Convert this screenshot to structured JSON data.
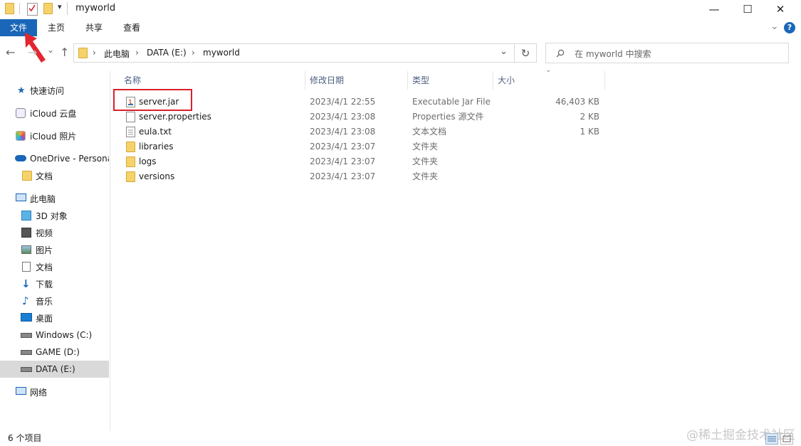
{
  "window": {
    "title": "myworld"
  },
  "title_controls": {
    "minimize": "—",
    "maximize": "☐",
    "close": "✕"
  },
  "ribbon": {
    "tabs": [
      "文件",
      "主页",
      "共享",
      "查看"
    ],
    "expand_glyph": "⌄",
    "help": "?"
  },
  "nav": {
    "back": "←",
    "forward": "→",
    "recent": "⌄",
    "up": "↑"
  },
  "address": {
    "segments": [
      "此电脑",
      "DATA (E:)",
      "myworld"
    ],
    "separator": "›",
    "dropdown": "⌄",
    "refresh": "↻"
  },
  "search": {
    "placeholder": "在 myworld 中搜索"
  },
  "sidebar": {
    "items": [
      {
        "label": "快速访问",
        "icon": "star-icon"
      },
      {
        "label": "iCloud 云盘",
        "icon": "icloud-icon"
      },
      {
        "label": "iCloud 照片",
        "icon": "icloud-photos-icon"
      },
      {
        "label": "OneDrive - Persona",
        "icon": "onedrive-icon"
      },
      {
        "label": "文档",
        "icon": "folder-icon"
      },
      {
        "label": "此电脑",
        "icon": "computer-icon"
      },
      {
        "label": "3D 对象",
        "icon": "cube-icon"
      },
      {
        "label": "视频",
        "icon": "video-icon"
      },
      {
        "label": "图片",
        "icon": "pictures-icon"
      },
      {
        "label": "文档",
        "icon": "documents-icon"
      },
      {
        "label": "下载",
        "icon": "download-icon"
      },
      {
        "label": "音乐",
        "icon": "music-icon"
      },
      {
        "label": "桌面",
        "icon": "desktop-icon"
      },
      {
        "label": "Windows (C:)",
        "icon": "drive-icon"
      },
      {
        "label": "GAME (D:)",
        "icon": "drive-icon"
      },
      {
        "label": "DATA (E:)",
        "icon": "drive-icon",
        "selected": true
      },
      {
        "label": "网络",
        "icon": "network-icon"
      }
    ]
  },
  "columns": {
    "name": "名称",
    "date": "修改日期",
    "type": "类型",
    "size": "大小",
    "sort_glyph": "⌄"
  },
  "files": [
    {
      "name": "server.jar",
      "date": "2023/4/1 22:55",
      "type": "Executable Jar File",
      "size": "46,403 KB",
      "icon": "jar-file-icon"
    },
    {
      "name": "server.properties",
      "date": "2023/4/1 23:08",
      "type": "Properties 源文件",
      "size": "2 KB",
      "icon": "document-icon"
    },
    {
      "name": "eula.txt",
      "date": "2023/4/1 23:08",
      "type": "文本文档",
      "size": "1 KB",
      "icon": "text-file-icon"
    },
    {
      "name": "libraries",
      "date": "2023/4/1 23:07",
      "type": "文件夹",
      "size": "",
      "icon": "folder-icon"
    },
    {
      "name": "logs",
      "date": "2023/4/1 23:07",
      "type": "文件夹",
      "size": "",
      "icon": "folder-icon"
    },
    {
      "name": "versions",
      "date": "2023/4/1 23:07",
      "type": "文件夹",
      "size": "",
      "icon": "folder-icon"
    }
  ],
  "status": {
    "item_count": "6 个项目"
  },
  "watermark": "@稀土掘金技术社区",
  "colors": {
    "accent": "#1a66b8",
    "highlight": "#d9202c",
    "arrow": "#e3262f"
  }
}
